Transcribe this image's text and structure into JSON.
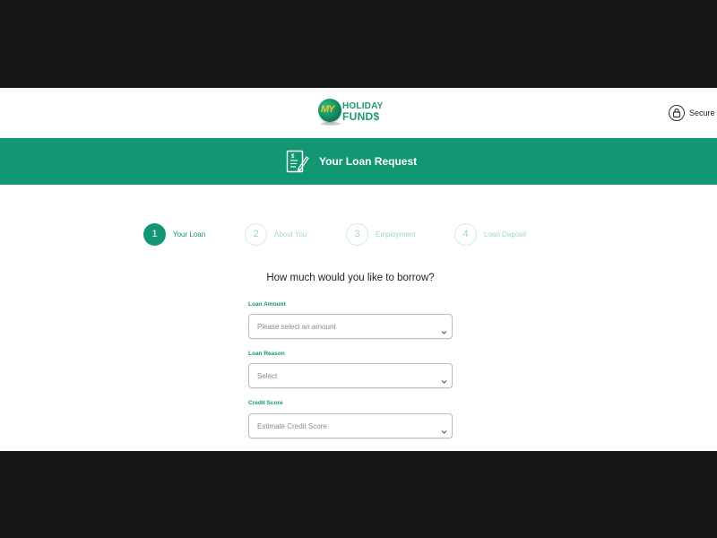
{
  "header": {
    "logo": {
      "globe_text": "MY",
      "line1": "HOLIDAY",
      "line2": "FUND$"
    },
    "secure_label": "Secure F"
  },
  "banner": {
    "title": "Your Loan Request",
    "icon": "document-pen-icon"
  },
  "steps": [
    {
      "number": "1",
      "label": "Your Loan",
      "active": true
    },
    {
      "number": "2",
      "label": "About You",
      "active": false
    },
    {
      "number": "3",
      "label": "Employment",
      "active": false
    },
    {
      "number": "4",
      "label": "Loan Deposit",
      "active": false
    }
  ],
  "form": {
    "question": "How much would you like to borrow?",
    "loan_amount": {
      "label": "Loan Amount",
      "value": "Please select an amount"
    },
    "loan_reason": {
      "label": "Loan Reason",
      "value": "Select"
    },
    "credit_score": {
      "label": "Credit Score",
      "value": "Estimate Credit Score"
    }
  },
  "colors": {
    "brand": "#129772",
    "step_idle": "#9dd9c6",
    "letterbox": "#151515"
  }
}
